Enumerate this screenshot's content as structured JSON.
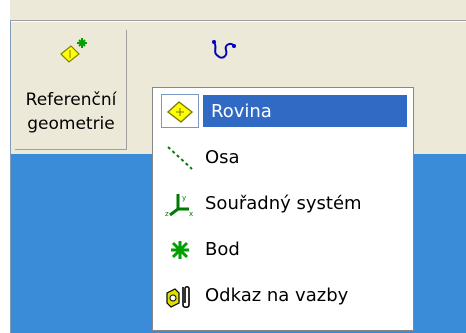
{
  "toolbar": {
    "reference_geometry_label_line1": "Referenční",
    "reference_geometry_label_line2": "geometrie"
  },
  "menu": {
    "items": [
      {
        "label": "Rovina",
        "icon": "plane-icon"
      },
      {
        "label": "Osa",
        "icon": "axis-icon"
      },
      {
        "label": "Souřadný systém",
        "icon": "coordinate-system-icon"
      },
      {
        "label": "Bod",
        "icon": "point-icon"
      },
      {
        "label": "Odkaz na vazby",
        "icon": "mate-reference-icon"
      }
    ],
    "selected_index": 0
  },
  "colors": {
    "highlight": "#316ac5",
    "canvas": "#3a8cd8",
    "toolbar_bg": "#ece9d8"
  }
}
